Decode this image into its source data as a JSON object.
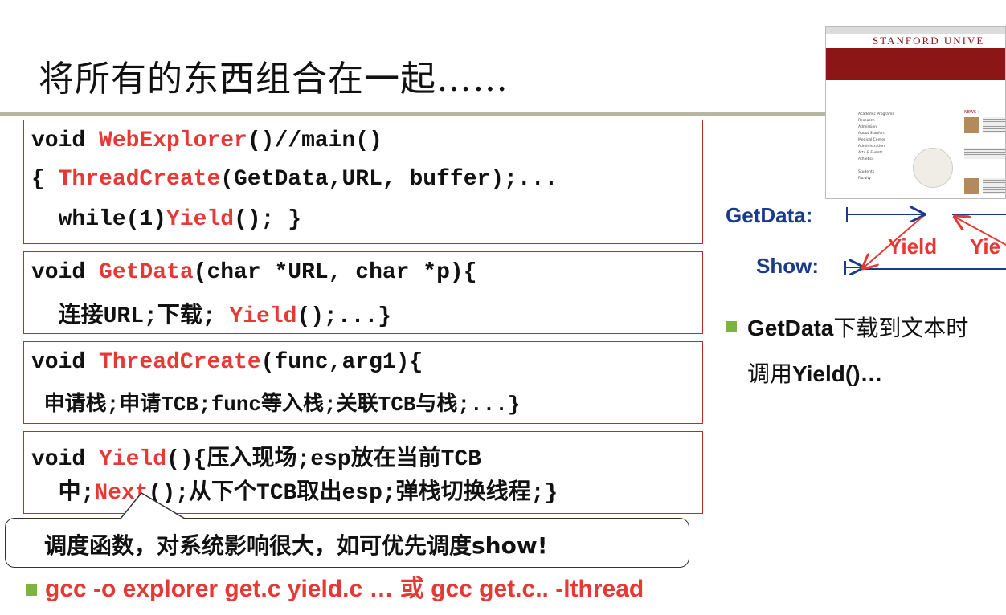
{
  "title": "将所有的东西组合在一起……",
  "box1": {
    "l1a": "void ",
    "l1b": "WebExplorer",
    "l1c": "()//main()",
    "l2a": "{ ",
    "l2b": "ThreadCreate",
    "l2c": "(GetData,URL, buffer);...",
    "l3a": "  while(1)",
    "l3b": "Yield",
    "l3c": "(); }"
  },
  "box2": {
    "l1a": "void ",
    "l1b": "GetData",
    "l1c": "(char *URL, char *p){",
    "l2a": "  连接URL;下载; ",
    "l2b": "Yield",
    "l2c": "();...}"
  },
  "box3": {
    "l1a": "void ",
    "l1b": "ThreadCreate",
    "l1c": "(func,arg1){",
    "l2": " 申请栈;申请TCB;func等入栈;关联TCB与栈;...}"
  },
  "box4": {
    "l1a": "void ",
    "l1b": "Yield",
    "l1c": "(){压入现场;esp放在当前TCB",
    "l2a": "  中;",
    "l2b": "Next",
    "l2c": "();从下个TCB取出esp;弹栈切换线程;}"
  },
  "callout": "调度函数，对系统影响很大，如可优先调度show!",
  "bottom": "gcc -o explorer get.c yield.c … 或 gcc get.c.. -lthread",
  "screenshot": {
    "header": "STANFORD UNIVE",
    "news": "NEWS »",
    "nav": [
      "Academic Programs",
      "Research",
      "Admission",
      "About Stanford",
      "Medical Center",
      "Administration",
      "Arts & Events",
      "Athletics",
      "",
      "Students",
      "Faculty"
    ]
  },
  "diagram": {
    "getdata": "GetData:",
    "show": "Show:",
    "yield1": "Yield",
    "yield2": "Yie"
  },
  "right_bullet": {
    "line1a": "GetData",
    "line1b": "下载到文本时",
    "line2a": "调用",
    "line2b": "Yield()…"
  },
  "colors": {
    "accent_red": "#e53935",
    "blue": "#1a3a8a",
    "bullet_green": "#7cb342",
    "stanford_red": "#8c1515"
  }
}
